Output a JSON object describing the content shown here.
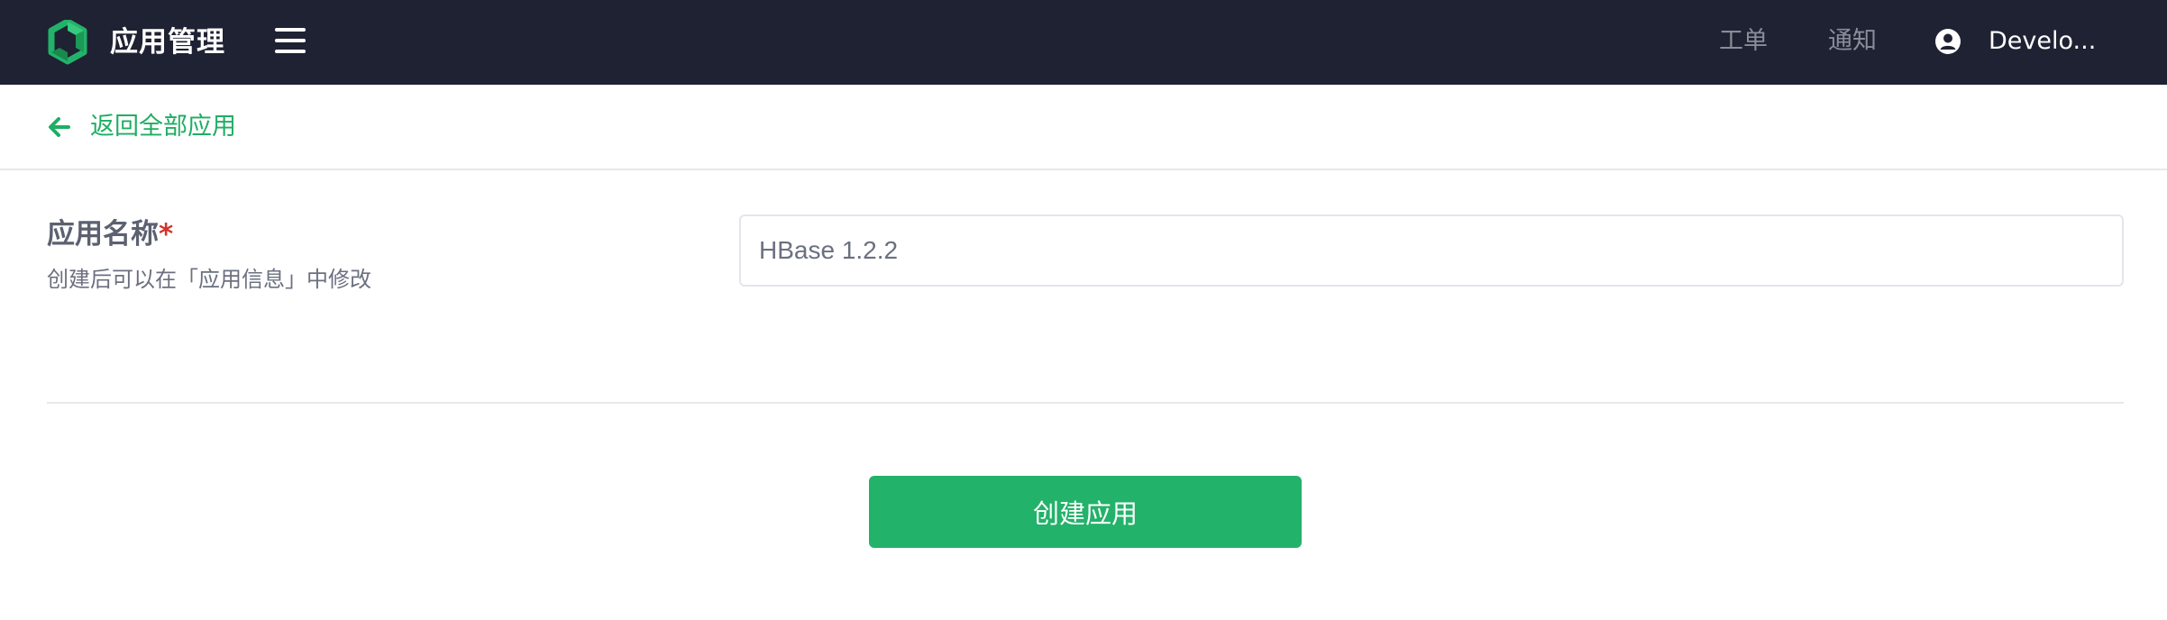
{
  "colors": {
    "topbar_bg": "#1f2233",
    "accent": "#23b26a",
    "link": "#1fae63",
    "required": "#d0342c"
  },
  "header": {
    "logo_icon": "hexagon-logo-icon",
    "title": "应用管理",
    "menu_icon": "hamburger-menu-icon",
    "nav": {
      "ticket": "工单",
      "notice": "通知"
    },
    "user_icon": "user-avatar-icon",
    "user_name": "Develo..."
  },
  "back": {
    "icon": "arrow-left-icon",
    "label": "返回全部应用"
  },
  "form": {
    "name_label": "应用名称",
    "required_mark": "*",
    "name_hint": "创建后可以在「应用信息」中修改",
    "name_value": "HBase 1.2.2"
  },
  "actions": {
    "create_label": "创建应用"
  }
}
